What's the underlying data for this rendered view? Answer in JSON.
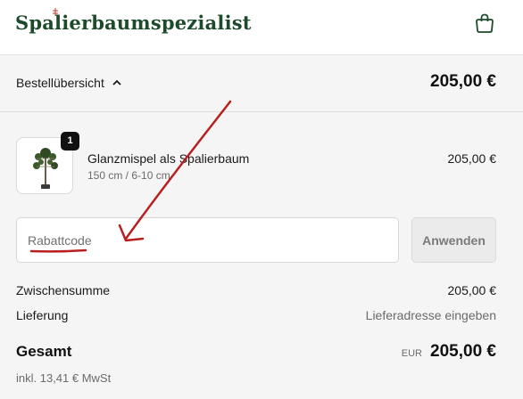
{
  "header": {
    "logo_text": "Spalierbaumspezialist",
    "cart_icon": "shopping-bag-icon"
  },
  "summary": {
    "label": "Bestellübersicht",
    "toggle_icon": "chevron-up-icon",
    "total": "205,00 €"
  },
  "line_item": {
    "quantity": "1",
    "name": "Glanzmispel als Spalierbaum",
    "variant": "150 cm / 6-10 cm",
    "price": "205,00 €"
  },
  "discount": {
    "placeholder": "Rabattcode",
    "apply_label": "Anwenden"
  },
  "costs": {
    "subtotal_label": "Zwischensumme",
    "subtotal_value": "205,00 €",
    "shipping_label": "Lieferung",
    "shipping_value": "Lieferadresse eingeben",
    "total_label": "Gesamt",
    "currency": "EUR",
    "total_value": "205,00 €",
    "tax_note": "inkl. 13,41 € MwSt"
  },
  "colors": {
    "brand": "#1d4a2a",
    "annotation": "#b81f1f"
  }
}
